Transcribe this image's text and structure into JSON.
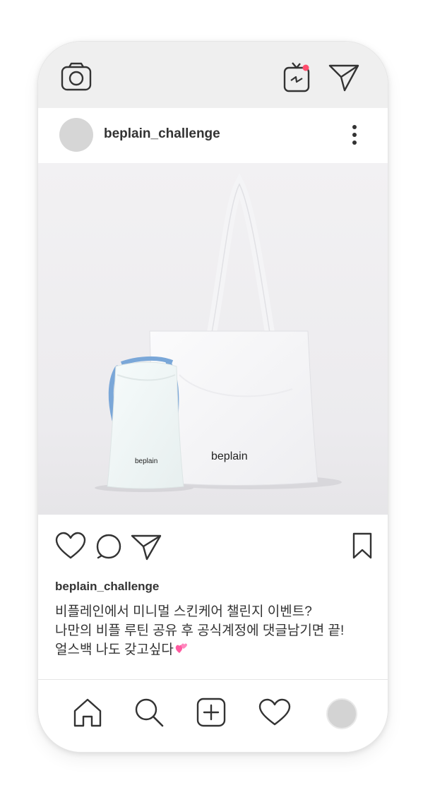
{
  "post": {
    "username": "beplain_challenge",
    "image": {
      "tote_logo": "beplain",
      "pouch_logo": "beplain"
    },
    "caption": {
      "username": "beplain_challenge",
      "lines": [
        "비플레인에서 미니멀 스킨케어 챌린지 이벤트?",
        "나만의 비플 루틴 공유 후 공식계정에 댓글남기면 끝!",
        "얼스백 나도 갖고싶다"
      ]
    }
  },
  "icons": {
    "top": [
      "camera-icon",
      "igtv-icon",
      "direct-icon"
    ],
    "post": [
      "more-icon",
      "like-icon",
      "comment-icon",
      "share-icon",
      "bookmark-icon"
    ],
    "nav": [
      "home-icon",
      "search-icon",
      "add-icon",
      "activity-icon",
      "profile-avatar"
    ]
  },
  "colors": {
    "topbar_bg": "#efefef",
    "notification_dot": "#ff4d6d",
    "pouch_strap": "#7aa7d8",
    "emoji_pink": "#ff5aa0"
  }
}
